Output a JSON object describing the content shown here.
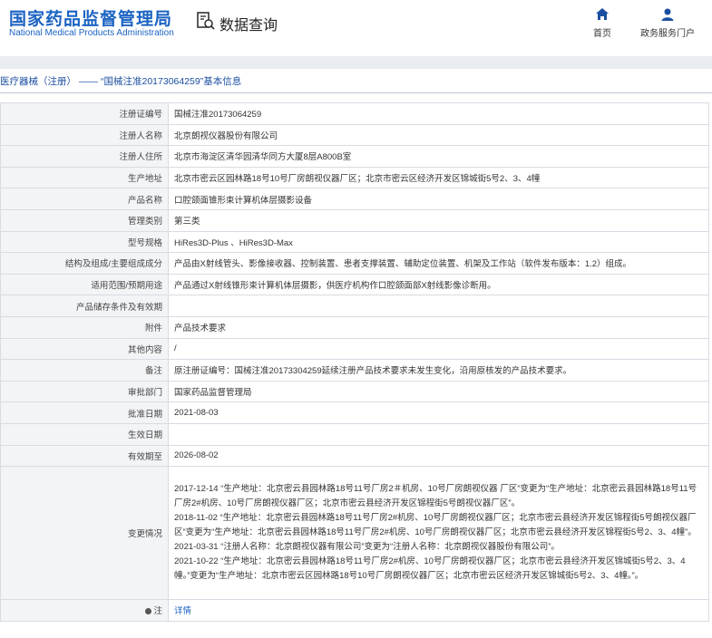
{
  "header": {
    "site_name_cn": "国家药品监督管理局",
    "site_name_en": "National Medical Products Administration",
    "query_label": "数据查询",
    "nav": {
      "home": "首页",
      "gov_service": "政务服务门户"
    }
  },
  "breadcrumb": {
    "category": "医疗器械（注册）",
    "separator": "——",
    "record": "“国械注准20173064259”基本信息"
  },
  "fields": [
    {
      "label": "注册证编号",
      "value": "国械注准20173064259"
    },
    {
      "label": "注册人名称",
      "value": "北京朗视仪器股份有限公司"
    },
    {
      "label": "注册人住所",
      "value": "北京市海淀区清华园清华同方大厦8层A800B室"
    },
    {
      "label": "生产地址",
      "value": "北京市密云区园林路18号10号厂房朗视仪器厂区；北京市密云区经济开发区锦城街5号2、3、4幢"
    },
    {
      "label": "产品名称",
      "value": "口腔颌面锥形束计算机体层摄影设备"
    },
    {
      "label": "管理类别",
      "value": "第三类"
    },
    {
      "label": "型号规格",
      "value": "HiRes3D-Plus 、HiRes3D-Max"
    },
    {
      "label": "结构及组成/主要组成成分",
      "value": "产品由X射线管头、影像接收器、控制装置、患者支撑装置、辅助定位装置、机架及工作站（软件发布版本：1.2）组成。"
    },
    {
      "label": "适用范围/预期用途",
      "value": "产品通过X射线锥形束计算机体层摄影，供医疗机构作口腔颌面部X射线影像诊断用。"
    },
    {
      "label": "产品储存条件及有效期",
      "value": ""
    },
    {
      "label": "附件",
      "value": "产品技术要求"
    },
    {
      "label": "其他内容",
      "value": "/"
    },
    {
      "label": "备注",
      "value": "原注册证编号：国械注准20173304259延续注册产品技术要求未发生变化，沿用原核发的产品技术要求。"
    },
    {
      "label": "审批部门",
      "value": "国家药品监督管理局"
    },
    {
      "label": "批准日期",
      "value": "2021-08-03"
    },
    {
      "label": "生效日期",
      "value": ""
    },
    {
      "label": "有效期至",
      "value": "2026-08-02"
    }
  ],
  "change": {
    "label": "变更情况",
    "entries": [
      "2017-12-14 “生产地址：北京密云县园林路18号11号厂房2＃机房、10号厂房朗视仪器 厂区”变更为“生产地址：北京密云县园林路18号11号厂房2#机房、10号厂房朗视仪器厂区；北京市密云县经济开发区锦程街5号朗视仪器厂区”。",
      "2018-11-02 “生产地址：北京密云县园林路18号11号厂房2#机房、10号厂房朗视仪器厂区；北京市密云县经济开发区锦程街5号朗视仪器厂区”变更为“生产地址：北京密云县园林路18号11号厂房2#机房、10号厂房朗视仪器厂区；北京市密云县经济开发区锦程街5号2、3、4幢”。",
      "2021-03-31 “注册人名称：北京朗视仪器有限公司”变更为“注册人名称：北京朗视仪器股份有限公司”。",
      "2021-10-22 “生产地址：北京密云县园林路18号11号厂房2#机房、10号厂房朗视仪器厂区；北京市密云县经济开发区锦城街5号2、3、4幢。”变更为“生产地址：北京市密云区园林路18号10号厂房朗视仪器厂区；北京市密云区经济开发区锦城街5号2、3、4幢。”。"
    ]
  },
  "note": {
    "label": "注",
    "link": "详情"
  }
}
